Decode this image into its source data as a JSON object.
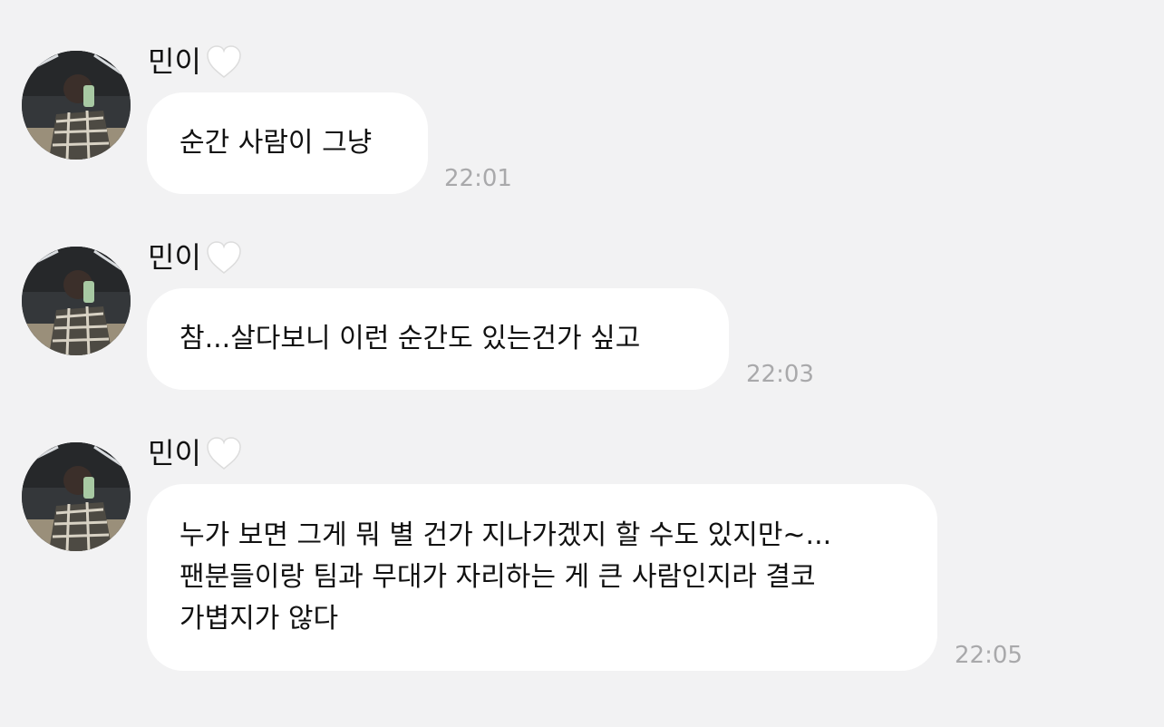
{
  "messages": [
    {
      "sender": "민이",
      "lines": [
        "순간 사람이 그냥"
      ],
      "time": "22:01"
    },
    {
      "sender": "민이",
      "lines": [
        "참...살다보니 이런 순간도 있는건가 싶고"
      ],
      "time": "22:03"
    },
    {
      "sender": "민이",
      "lines": [
        "누가 보면 그게 뭐 별 건가 지나가겠지 할 수도 있지만~...",
        "팬분들이랑 팀과 무대가 자리하는 게 큰 사람인지라 결코",
        "가볍지가 않다"
      ],
      "time": "22:05"
    }
  ],
  "colors": {
    "background": "#f2f2f3",
    "bubble": "#ffffff",
    "text": "#111111",
    "timestamp": "#a9a9ab",
    "heart": "#ffffff"
  },
  "icons": {
    "avatar": "profile-photo",
    "heart": "white-heart-icon"
  }
}
